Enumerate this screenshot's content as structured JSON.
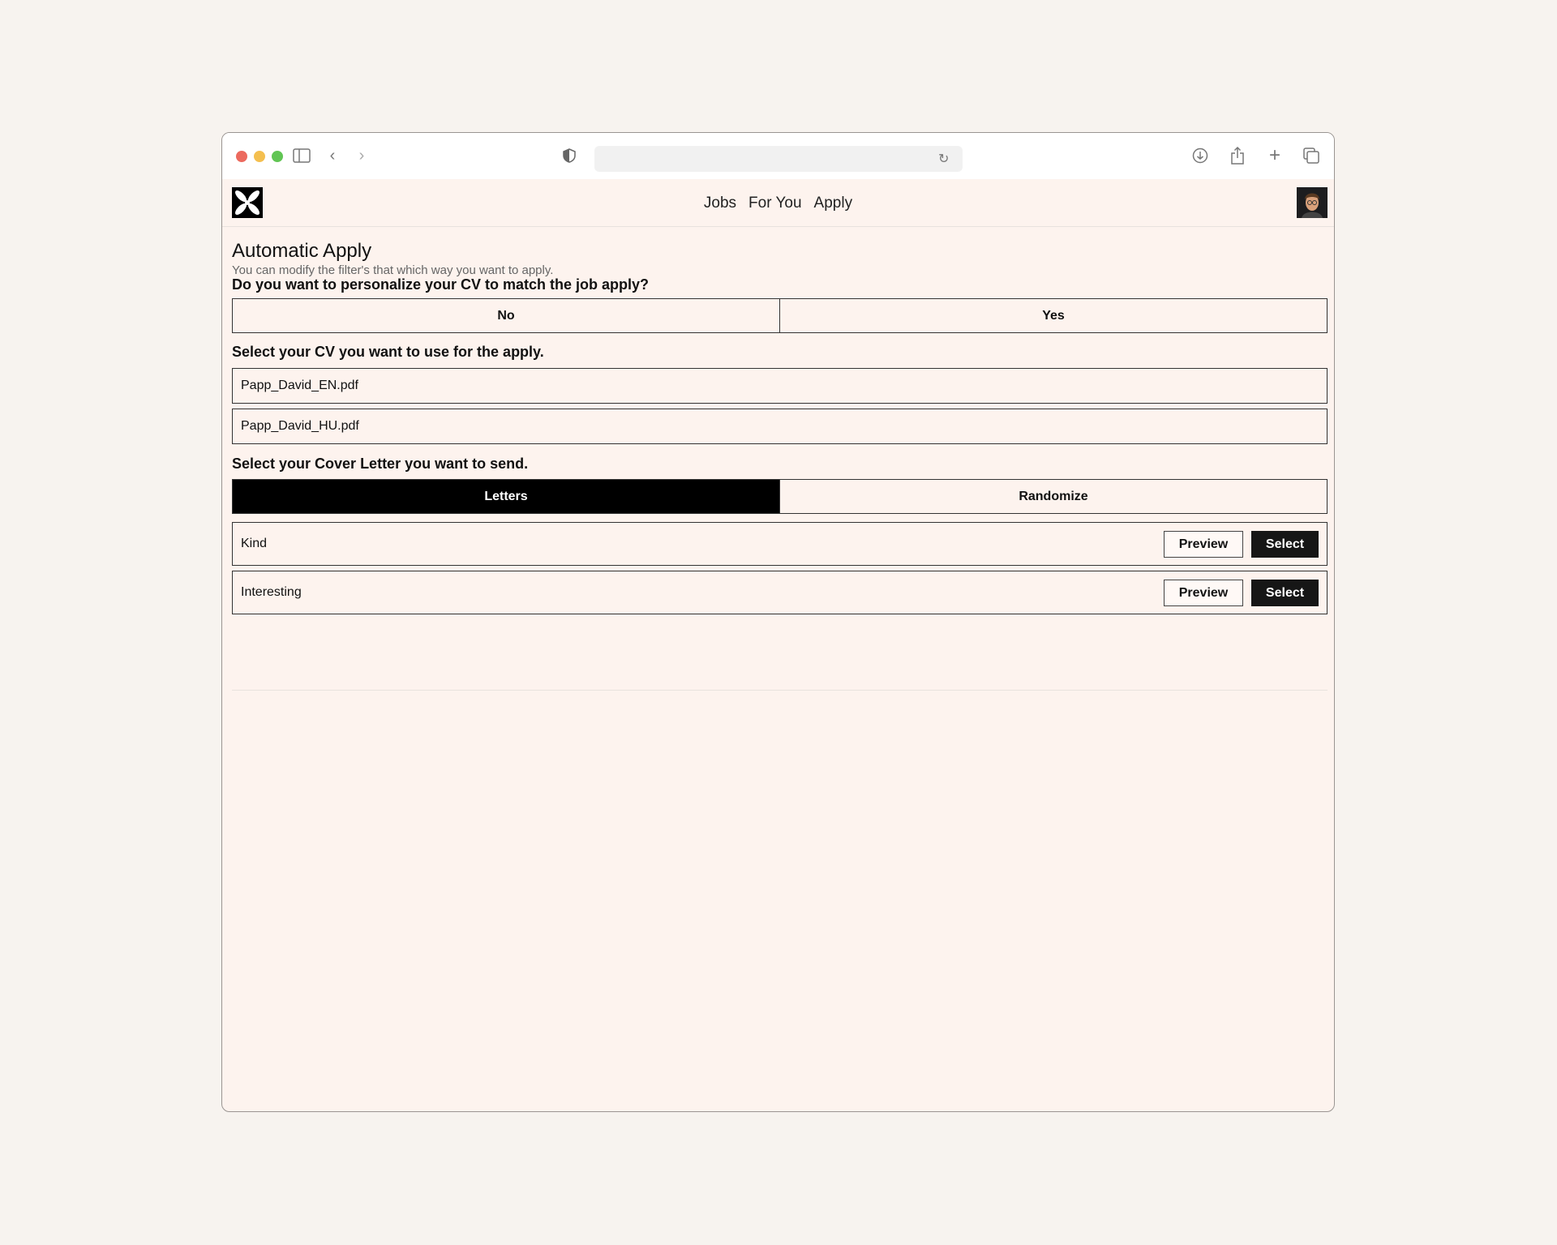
{
  "browser": {
    "icons": [
      "sidebar-icon",
      "back-icon",
      "forward-icon",
      "shield-icon",
      "reload-icon",
      "download-icon",
      "share-icon",
      "new-tab-icon",
      "tabs-icon"
    ]
  },
  "nav": {
    "links": [
      "Jobs",
      "For You",
      "Apply"
    ]
  },
  "page": {
    "title": "Automatic Apply",
    "subtitle": "You can modify the filter's that which way you want to apply.",
    "personalize": {
      "question": "Do you want to personalize your CV to match the job apply?",
      "options": [
        "No",
        "Yes"
      ]
    },
    "cv": {
      "label": "Select your CV you want to use for the apply.",
      "files": [
        "Papp_David_EN.pdf",
        "Papp_David_HU.pdf"
      ]
    },
    "cover": {
      "label": "Select your Cover Letter you want to send.",
      "tabs": [
        "Letters",
        "Randomize"
      ],
      "active_tab": "Letters",
      "letters": [
        {
          "name": "Kind",
          "preview": "Preview",
          "select": "Select"
        },
        {
          "name": "Interesting",
          "preview": "Preview",
          "select": "Select"
        }
      ]
    }
  }
}
